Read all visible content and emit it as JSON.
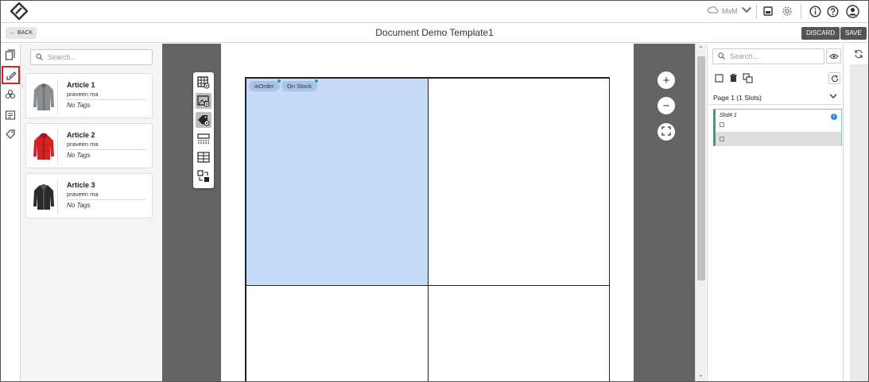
{
  "header": {
    "user_label": "MxM",
    "colors": {
      "border": "#d7d7d7",
      "icon": "#333333"
    }
  },
  "titlebar": {
    "back_label": "BACK",
    "title": "Document Demo Template1",
    "discard_label": "DISCARD",
    "save_label": "SAVE"
  },
  "rail": {
    "items": [
      {
        "icon": "documents-icon"
      },
      {
        "icon": "edit-layout-icon",
        "active": true
      },
      {
        "icon": "components-icon"
      },
      {
        "icon": "list-icon"
      },
      {
        "icon": "tag-icon"
      }
    ],
    "active_color": "#e02020"
  },
  "articles": {
    "search_placeholder": "Search...",
    "items": [
      {
        "name": "Article 1",
        "owner": "praveen ma",
        "tags": "No Tags",
        "image": "grey-jacket"
      },
      {
        "name": "Article 2",
        "owner": "praveen ma",
        "tags": "No Tags",
        "image": "red-jacket"
      },
      {
        "name": "Article 3",
        "owner": "praveen ma",
        "tags": "No Tags",
        "image": "black-jacket"
      }
    ]
  },
  "canvas": {
    "chips": [
      "isOrder",
      "On Stock"
    ],
    "selected_cell_color": "#c5dbf7",
    "tools": [
      "grid-view-icon",
      "image-icon",
      "tag-view-icon",
      "banner-icon",
      "table-icon",
      "swap-icon"
    ],
    "zoom": {
      "in": "+",
      "out": "−"
    }
  },
  "slots_panel": {
    "search_placeholder": "Search...",
    "page_label": "Page 1 (1 Slots)",
    "slot_title": "Slot# 1"
  }
}
